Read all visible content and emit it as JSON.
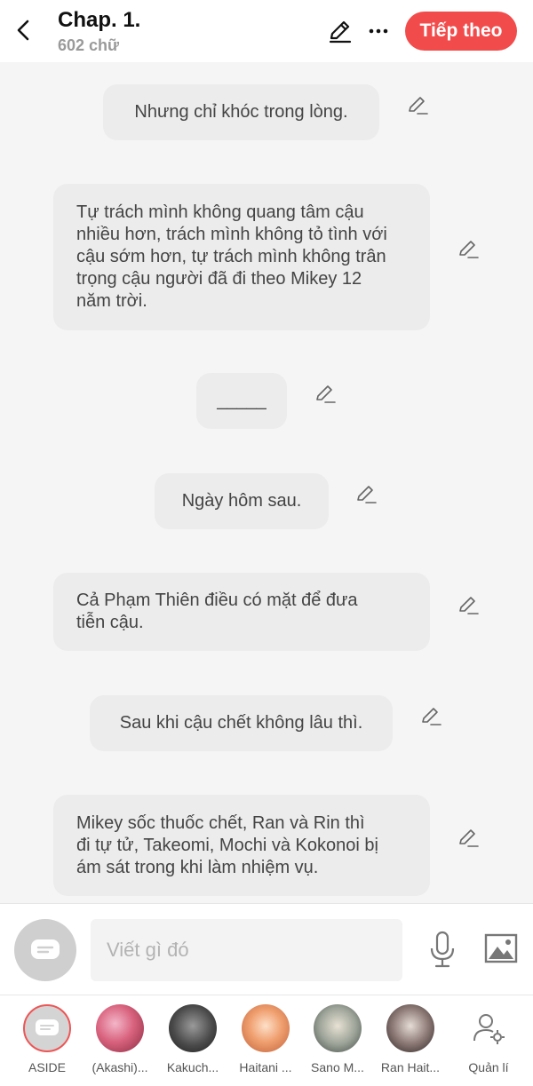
{
  "header": {
    "title": "Chap. 1.",
    "word_count": "602 chữ",
    "next_label": "Tiếp theo"
  },
  "messages": [
    "Nhưng chỉ khóc trong lòng.",
    "Tự trách mình không quang tâm cậu\nnhiều hơn, trách mình không tỏ tình với\ncậu sớm hơn, tự trách mình không trân\ntrọng cậu người đã đi theo Mikey 12\nnăm trời.",
    "_____",
    "Ngày hôm sau.",
    "Cả Phạm Thiên điều có mặt để đưa\ntiễn cậu.",
    "Sau khi cậu chết không lâu thì.",
    "Mikey sốc thuốc chết, Ran và Rin thì\nđi tự tử, Takeomi, Mochi và Kokonoi bị\nám sát trong khi làm nhiệm vụ."
  ],
  "input": {
    "placeholder": "Viết gì đó"
  },
  "characters": [
    {
      "label": "ASIDE"
    },
    {
      "label": "(Akashi)..."
    },
    {
      "label": "Kakuch..."
    },
    {
      "label": "Haitani ..."
    },
    {
      "label": "Sano M..."
    },
    {
      "label": "Ran Hait..."
    },
    {
      "label": "Quản lí"
    }
  ],
  "colors": {
    "accent": "#f24b4b",
    "bubble": "#ececec",
    "background": "#f5f5f5"
  },
  "icons": [
    "back-arrow-icon",
    "edit-pencil-icon",
    "more-dots-icon",
    "pencil-icon",
    "chat-bubble-icon",
    "microphone-icon",
    "image-icon",
    "manage-user-icon"
  ]
}
